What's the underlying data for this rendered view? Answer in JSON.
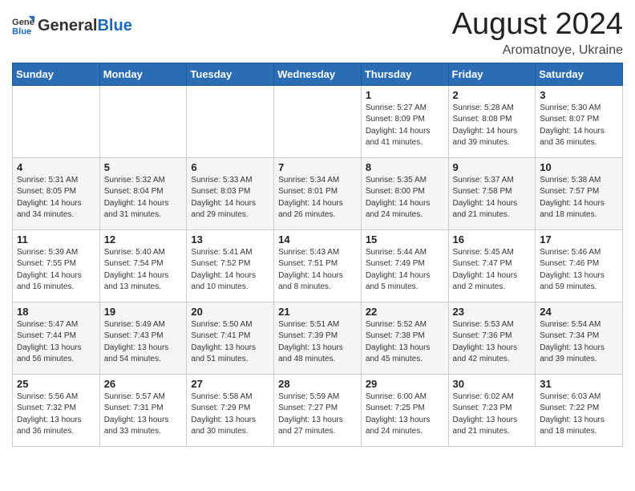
{
  "header": {
    "logo_general": "General",
    "logo_blue": "Blue",
    "month_year": "August 2024",
    "location": "Aromatnoye, Ukraine"
  },
  "weekdays": [
    "Sunday",
    "Monday",
    "Tuesday",
    "Wednesday",
    "Thursday",
    "Friday",
    "Saturday"
  ],
  "weeks": [
    [
      {
        "day": "",
        "detail": ""
      },
      {
        "day": "",
        "detail": ""
      },
      {
        "day": "",
        "detail": ""
      },
      {
        "day": "",
        "detail": ""
      },
      {
        "day": "1",
        "detail": "Sunrise: 5:27 AM\nSunset: 8:09 PM\nDaylight: 14 hours\nand 41 minutes."
      },
      {
        "day": "2",
        "detail": "Sunrise: 5:28 AM\nSunset: 8:08 PM\nDaylight: 14 hours\nand 39 minutes."
      },
      {
        "day": "3",
        "detail": "Sunrise: 5:30 AM\nSunset: 8:07 PM\nDaylight: 14 hours\nand 36 minutes."
      }
    ],
    [
      {
        "day": "4",
        "detail": "Sunrise: 5:31 AM\nSunset: 8:05 PM\nDaylight: 14 hours\nand 34 minutes."
      },
      {
        "day": "5",
        "detail": "Sunrise: 5:32 AM\nSunset: 8:04 PM\nDaylight: 14 hours\nand 31 minutes."
      },
      {
        "day": "6",
        "detail": "Sunrise: 5:33 AM\nSunset: 8:03 PM\nDaylight: 14 hours\nand 29 minutes."
      },
      {
        "day": "7",
        "detail": "Sunrise: 5:34 AM\nSunset: 8:01 PM\nDaylight: 14 hours\nand 26 minutes."
      },
      {
        "day": "8",
        "detail": "Sunrise: 5:35 AM\nSunset: 8:00 PM\nDaylight: 14 hours\nand 24 minutes."
      },
      {
        "day": "9",
        "detail": "Sunrise: 5:37 AM\nSunset: 7:58 PM\nDaylight: 14 hours\nand 21 minutes."
      },
      {
        "day": "10",
        "detail": "Sunrise: 5:38 AM\nSunset: 7:57 PM\nDaylight: 14 hours\nand 18 minutes."
      }
    ],
    [
      {
        "day": "11",
        "detail": "Sunrise: 5:39 AM\nSunset: 7:55 PM\nDaylight: 14 hours\nand 16 minutes."
      },
      {
        "day": "12",
        "detail": "Sunrise: 5:40 AM\nSunset: 7:54 PM\nDaylight: 14 hours\nand 13 minutes."
      },
      {
        "day": "13",
        "detail": "Sunrise: 5:41 AM\nSunset: 7:52 PM\nDaylight: 14 hours\nand 10 minutes."
      },
      {
        "day": "14",
        "detail": "Sunrise: 5:43 AM\nSunset: 7:51 PM\nDaylight: 14 hours\nand 8 minutes."
      },
      {
        "day": "15",
        "detail": "Sunrise: 5:44 AM\nSunset: 7:49 PM\nDaylight: 14 hours\nand 5 minutes."
      },
      {
        "day": "16",
        "detail": "Sunrise: 5:45 AM\nSunset: 7:47 PM\nDaylight: 14 hours\nand 2 minutes."
      },
      {
        "day": "17",
        "detail": "Sunrise: 5:46 AM\nSunset: 7:46 PM\nDaylight: 13 hours\nand 59 minutes."
      }
    ],
    [
      {
        "day": "18",
        "detail": "Sunrise: 5:47 AM\nSunset: 7:44 PM\nDaylight: 13 hours\nand 56 minutes."
      },
      {
        "day": "19",
        "detail": "Sunrise: 5:49 AM\nSunset: 7:43 PM\nDaylight: 13 hours\nand 54 minutes."
      },
      {
        "day": "20",
        "detail": "Sunrise: 5:50 AM\nSunset: 7:41 PM\nDaylight: 13 hours\nand 51 minutes."
      },
      {
        "day": "21",
        "detail": "Sunrise: 5:51 AM\nSunset: 7:39 PM\nDaylight: 13 hours\nand 48 minutes."
      },
      {
        "day": "22",
        "detail": "Sunrise: 5:52 AM\nSunset: 7:38 PM\nDaylight: 13 hours\nand 45 minutes."
      },
      {
        "day": "23",
        "detail": "Sunrise: 5:53 AM\nSunset: 7:36 PM\nDaylight: 13 hours\nand 42 minutes."
      },
      {
        "day": "24",
        "detail": "Sunrise: 5:54 AM\nSunset: 7:34 PM\nDaylight: 13 hours\nand 39 minutes."
      }
    ],
    [
      {
        "day": "25",
        "detail": "Sunrise: 5:56 AM\nSunset: 7:32 PM\nDaylight: 13 hours\nand 36 minutes."
      },
      {
        "day": "26",
        "detail": "Sunrise: 5:57 AM\nSunset: 7:31 PM\nDaylight: 13 hours\nand 33 minutes."
      },
      {
        "day": "27",
        "detail": "Sunrise: 5:58 AM\nSunset: 7:29 PM\nDaylight: 13 hours\nand 30 minutes."
      },
      {
        "day": "28",
        "detail": "Sunrise: 5:59 AM\nSunset: 7:27 PM\nDaylight: 13 hours\nand 27 minutes."
      },
      {
        "day": "29",
        "detail": "Sunrise: 6:00 AM\nSunset: 7:25 PM\nDaylight: 13 hours\nand 24 minutes."
      },
      {
        "day": "30",
        "detail": "Sunrise: 6:02 AM\nSunset: 7:23 PM\nDaylight: 13 hours\nand 21 minutes."
      },
      {
        "day": "31",
        "detail": "Sunrise: 6:03 AM\nSunset: 7:22 PM\nDaylight: 13 hours\nand 18 minutes."
      }
    ]
  ]
}
